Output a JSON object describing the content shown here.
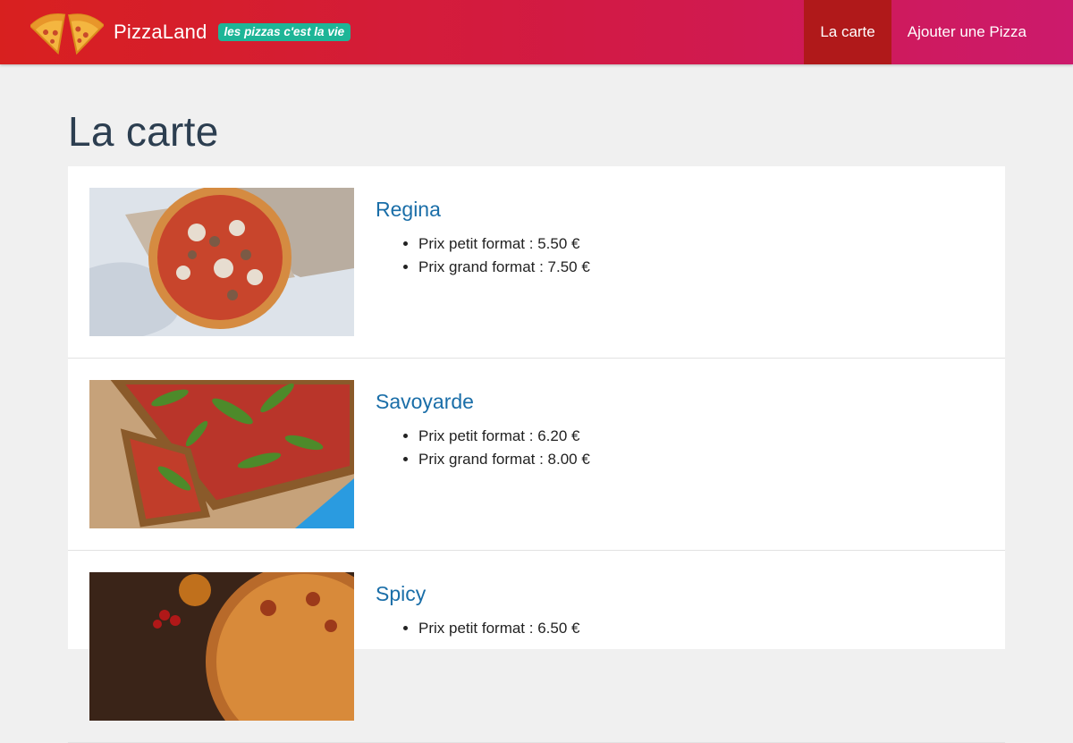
{
  "header": {
    "brand_name": "PizzaLand",
    "tagline": "les pizzas c'est la vie",
    "nav": [
      {
        "label": "La carte",
        "active": true
      },
      {
        "label": "Ajouter une Pizza",
        "active": false
      }
    ]
  },
  "page": {
    "title": "La carte"
  },
  "pizzas": [
    {
      "name": "Regina",
      "small_price": "Prix petit format : 5.50 €",
      "large_price": "Prix grand format : 7.50 €"
    },
    {
      "name": "Savoyarde",
      "small_price": "Prix petit format : 6.20 €",
      "large_price": "Prix grand format : 8.00 €"
    },
    {
      "name": "Spicy",
      "small_price": "Prix petit format : 6.50 €",
      "large_price": ""
    }
  ],
  "colors": {
    "header_gradient_start": "#d8201f",
    "header_gradient_end": "#cc1a6c",
    "active_nav": "#b0191a",
    "tagline_bg": "#1eb597",
    "pizza_name": "#1a6ea8",
    "title": "#2c3e50"
  }
}
